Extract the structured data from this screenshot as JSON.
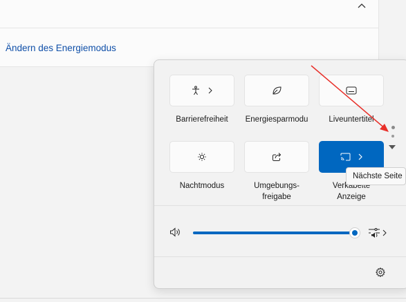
{
  "settings_page": {
    "energy_mode_link": "Ändern des Energiemodus"
  },
  "quick_settings": {
    "tiles": [
      {
        "label": "Barrierefreiheit",
        "icon": "accessibility-icon",
        "has_chevron": true,
        "active": false
      },
      {
        "label": "Energiesparmodu",
        "icon": "leaf-icon",
        "has_chevron": false,
        "active": false
      },
      {
        "label": "Liveuntertitel",
        "icon": "captions-icon",
        "has_chevron": false,
        "active": false
      },
      {
        "label": "Nachtmodus",
        "icon": "brightness-icon",
        "has_chevron": false,
        "active": false
      },
      {
        "label_line1": "Umgebungs-",
        "label_line2": "freigabe",
        "icon": "share-icon",
        "has_chevron": false,
        "active": false
      },
      {
        "label_line1": "Verkabelte",
        "label_line2": "Anzeige",
        "icon": "cast-icon",
        "has_chevron": true,
        "active": true
      }
    ],
    "volume": {
      "level": 1.0,
      "icon": "speaker-icon",
      "output_icon": "audio-output-icon"
    },
    "page_indicator": {
      "pages": 2,
      "current": 1
    },
    "next_page_tooltip": "Nächste Seite",
    "footer_icon": "gear-icon"
  },
  "colors": {
    "accent": "#0067c0",
    "annotation_arrow": "#e8302a"
  }
}
